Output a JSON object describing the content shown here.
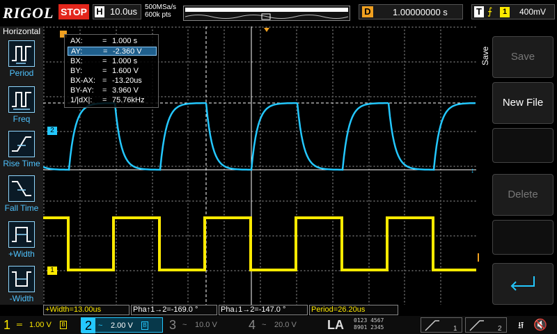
{
  "topbar": {
    "brand": "RIGOL",
    "run_state": "STOP",
    "timebase_tag": "H",
    "timebase": "10.0us",
    "sample_rate": "500MSa/s",
    "mem_depth": "600k pts",
    "delay_tag": "D",
    "delay": "1.00000000 s",
    "trigger_tag": "T",
    "trigger_source": "1",
    "trigger_level": "400mV"
  },
  "left_panel": {
    "title": "Horizontal",
    "items": [
      {
        "label": "Period",
        "icon": "period-icon"
      },
      {
        "label": "Freq",
        "icon": "freq-icon"
      },
      {
        "label": "Rise Time",
        "icon": "rise-time-icon"
      },
      {
        "label": "Fall Time",
        "icon": "fall-time-icon"
      },
      {
        "label": "+Width",
        "icon": "pos-width-icon"
      },
      {
        "label": "-Width",
        "icon": "neg-width-icon"
      }
    ]
  },
  "cursor": {
    "rows": [
      {
        "key": "AX:",
        "value": "1.000 s"
      },
      {
        "key": "AY:",
        "value": "-2.360 V"
      },
      {
        "key": "BX:",
        "value": "1.000 s"
      },
      {
        "key": "BY:",
        "value": "1.600 V"
      },
      {
        "key": "BX-AX:",
        "value": "-13.20us"
      },
      {
        "key": "BY-AY:",
        "value": "3.960 V"
      },
      {
        "key": "1/|dX|:",
        "value": "75.76kHz"
      }
    ],
    "equals": "="
  },
  "channel_markers": {
    "ch1": "1",
    "ch2": "2"
  },
  "right_panel": {
    "menu_title": "Save",
    "buttons": [
      {
        "label": "Save",
        "enabled": false
      },
      {
        "label": "New File",
        "enabled": true
      },
      {
        "label": "Delete",
        "enabled": false
      }
    ]
  },
  "measurements": [
    {
      "text": "+Width=13.00us",
      "color": "yellow"
    },
    {
      "text": "Pha↑1→2=-169.0 °",
      "color": "white"
    },
    {
      "text": "Pha↓1→2=-147.0 °",
      "color": "white"
    },
    {
      "text": "Period=26.20us",
      "color": "yellow"
    }
  ],
  "channels": [
    {
      "num": "1",
      "coupling": "═",
      "scale": "1.00 V",
      "bw": "B"
    },
    {
      "num": "2",
      "coupling": "~",
      "scale": "2.00 V",
      "bw": "B"
    },
    {
      "num": "3",
      "coupling": "~",
      "scale": "10.0 V",
      "bw": ""
    },
    {
      "num": "4",
      "coupling": "~",
      "scale": "20.0 V",
      "bw": ""
    }
  ],
  "la": {
    "label": "LA",
    "row1": "0123 4567",
    "row2": "8901 2345"
  },
  "colors": {
    "ch1": "#ffea00",
    "ch2": "#24c8ff",
    "stop": "#e3261c",
    "trigger": "#f0a020"
  }
}
